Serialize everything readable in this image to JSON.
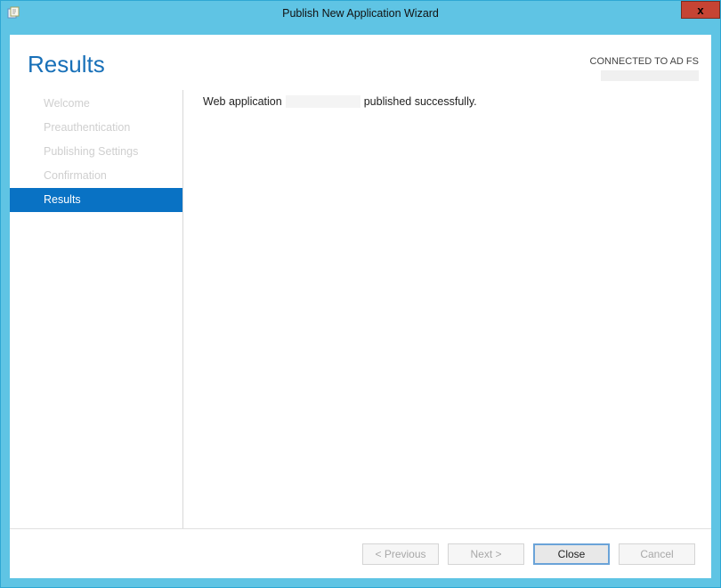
{
  "window": {
    "title": "Publish New Application Wizard"
  },
  "header": {
    "page_title": "Results",
    "connected_label": "CONNECTED TO AD FS"
  },
  "sidebar": {
    "steps": {
      "welcome": "Welcome",
      "preauth": "Preauthentication",
      "pubset": "Publishing Settings",
      "confirm": "Confirmation",
      "results": "Results"
    }
  },
  "main": {
    "msg_prefix": "Web application",
    "msg_suffix": "published successfully."
  },
  "footer": {
    "previous": "< Previous",
    "next": "Next >",
    "close": "Close",
    "cancel": "Cancel"
  }
}
